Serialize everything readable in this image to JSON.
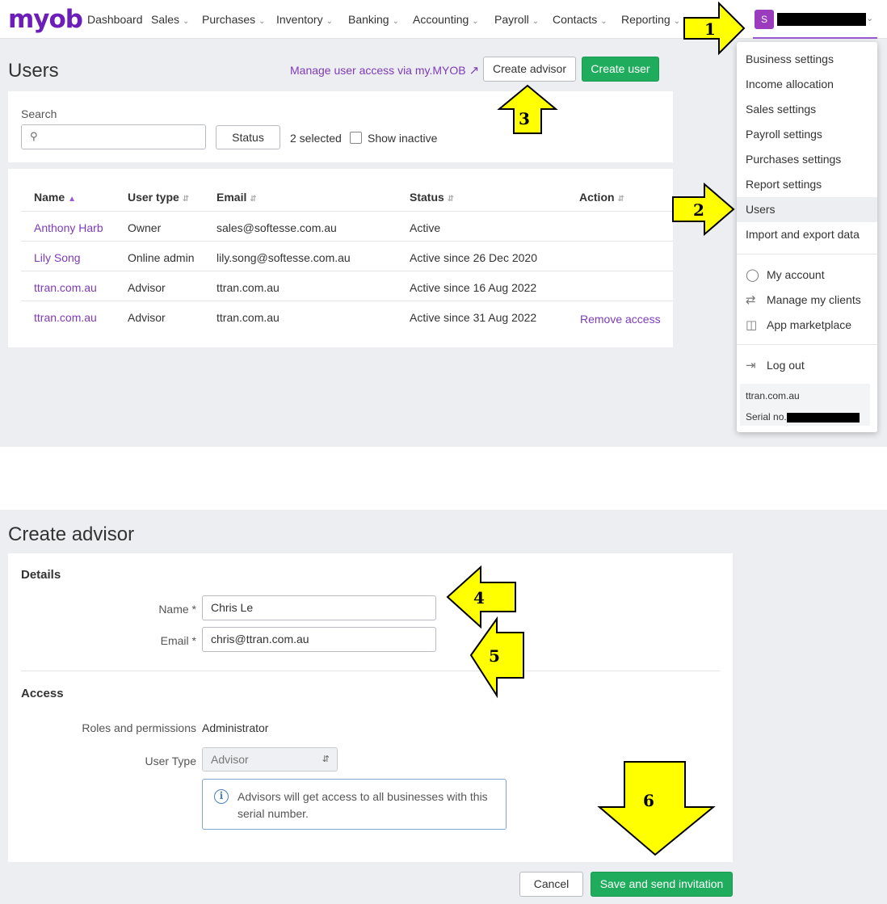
{
  "brand": {
    "logo": "myob",
    "accent": "#6d1db8",
    "primary_button_color": "#1fad5d",
    "link_color": "#7e3bb8"
  },
  "nav": {
    "items": [
      {
        "label": "Dashboard",
        "has_dropdown": false
      },
      {
        "label": "Sales",
        "has_dropdown": true
      },
      {
        "label": "Purchases",
        "has_dropdown": true
      },
      {
        "label": "Inventory",
        "has_dropdown": true
      },
      {
        "label": "Banking",
        "has_dropdown": true
      },
      {
        "label": "Accounting",
        "has_dropdown": true
      },
      {
        "label": "Payroll",
        "has_dropdown": true
      },
      {
        "label": "Contacts",
        "has_dropdown": true
      },
      {
        "label": "Reporting",
        "has_dropdown": true
      }
    ],
    "user_avatar": "S",
    "dropdown_icon": "chevron-down-icon"
  },
  "users_page": {
    "title": "Users",
    "manage_link": "Manage user access via my.MYOB",
    "create_advisor_button": "Create advisor",
    "create_user_button": "Create user",
    "filter": {
      "search_label": "Search",
      "search_value": "",
      "status_button": "Status",
      "selected_text": "2 selected",
      "show_inactive_label": "Show inactive",
      "show_inactive_checked": false
    },
    "table": {
      "columns": [
        "Name",
        "User type",
        "Email",
        "Status",
        "Action"
      ],
      "sorted_column": "Name",
      "rows": [
        {
          "name": "Anthony Harb",
          "user_type": "Owner",
          "email": "sales@softesse.com.au",
          "status": "Active",
          "action": ""
        },
        {
          "name": "Lily Song",
          "user_type": "Online admin",
          "email": "lily.song@softesse.com.au",
          "status": "Active since 26 Dec 2020",
          "action": ""
        },
        {
          "name": "ttran.com.au",
          "user_type": "Advisor",
          "email": "ttran.com.au",
          "status": "Active since 16 Aug 2022",
          "action": ""
        },
        {
          "name": "ttran.com.au",
          "user_type": "Advisor",
          "email": "ttran.com.au",
          "status": "Active since 31 Aug 2022",
          "action": "Remove access"
        }
      ]
    }
  },
  "user_menu": {
    "settings_items": [
      "Business settings",
      "Income allocation",
      "Sales settings",
      "Payroll settings",
      "Purchases settings",
      "Report settings",
      "Users",
      "Import and export data"
    ],
    "active_item": "Users",
    "account_items": [
      {
        "label": "My account",
        "icon": "person-icon"
      },
      {
        "label": "Manage my clients",
        "icon": "shuffle-icon"
      },
      {
        "label": "App marketplace",
        "icon": "basket-icon"
      }
    ],
    "logout": {
      "label": "Log out",
      "icon": "logout-icon"
    },
    "footer_company": "ttran.com.au",
    "footer_serial_label": "Serial no."
  },
  "create_advisor": {
    "title": "Create advisor",
    "details_title": "Details",
    "name_label": "Name *",
    "name_value": "Chris Le",
    "email_label": "Email *",
    "email_value": "chris@ttran.com.au",
    "access_title": "Access",
    "roles_label": "Roles and permissions",
    "roles_value": "Administrator",
    "user_type_label": "User Type",
    "user_type_value": "Advisor",
    "info_text": "Advisors will get access to all businesses with this serial number.",
    "cancel_button": "Cancel",
    "save_button": "Save and send invitation"
  },
  "annotations": {
    "color": "#ffff00",
    "steps": [
      "1",
      "2",
      "3",
      "4",
      "5",
      "6"
    ]
  }
}
